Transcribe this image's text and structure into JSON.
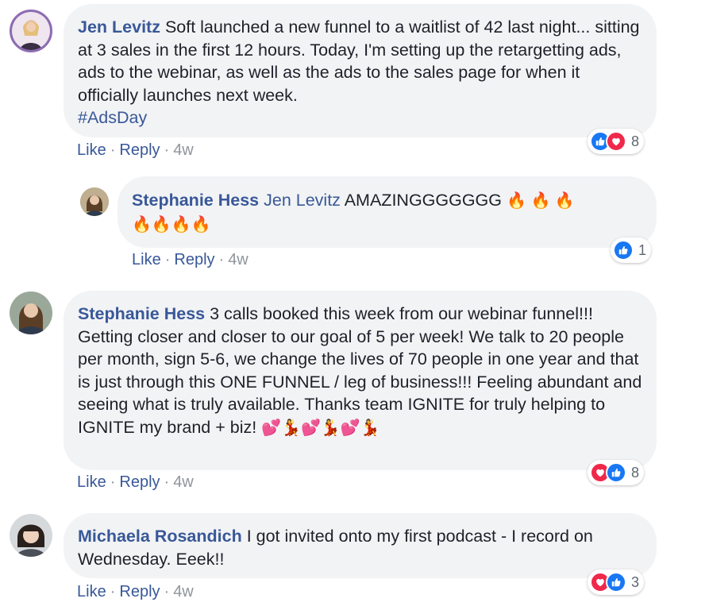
{
  "comments": [
    {
      "author": "Jen Levitz",
      "text": "Soft launched a new funnel to a waitlist of 42 last night... sitting at 3 sales in the first 12 hours. Today, I'm setting up the retargetting ads, ads to the webinar, as well as the ads to the sales page for when it officially launches next week.",
      "hashtag": "#AdsDay",
      "like_label": "Like",
      "reply_label": "Reply",
      "time": "4w",
      "reactions": [
        "like-icon",
        "love-icon"
      ],
      "reaction_count": "8",
      "reply": {
        "author": "Stephanie Hess",
        "mention": "Jen Levitz",
        "text": "AMAZINGGGGGGG",
        "emoji_line1": "🔥 🔥 🔥",
        "emoji_line2": "🔥🔥🔥🔥",
        "like_label": "Like",
        "reply_label": "Reply",
        "time": "4w",
        "reactions": [
          "like-icon"
        ],
        "reaction_count": "1"
      }
    },
    {
      "author": "Stephanie Hess",
      "text": "3 calls booked this week from our webinar funnel!!! Getting closer and closer to our goal of 5 per week! We talk to 20 people per month, sign 5-6, we change the lives of 70 people in one year and that is just through this ONE FUNNEL / leg of business!!! Feeling abundant and seeing what is truly available. Thanks team IGNITE for truly helping to IGNITE my brand + biz!",
      "emojis": "💕💃💕💃💕💃",
      "like_label": "Like",
      "reply_label": "Reply",
      "time": "4w",
      "reactions": [
        "love-icon",
        "like-icon"
      ],
      "reaction_count": "8"
    },
    {
      "author": "Michaela Rosandich",
      "text": "I got invited onto my first podcast - I record on Wednesday. Eeek!!",
      "like_label": "Like",
      "reply_label": "Reply",
      "time": "4w",
      "reactions": [
        "love-icon",
        "like-icon"
      ],
      "reaction_count": "3"
    }
  ],
  "colors": {
    "link": "#385898",
    "bubble": "#f2f3f5",
    "meta": "#90949c",
    "like": "#1877f2",
    "love": "#f0284a"
  }
}
